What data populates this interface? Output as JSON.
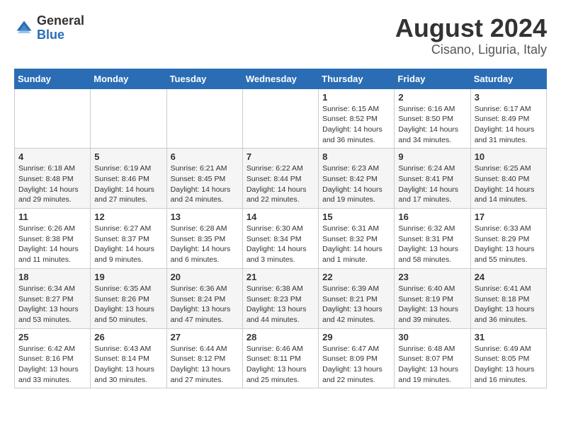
{
  "logo": {
    "general": "General",
    "blue": "Blue"
  },
  "title": "August 2024",
  "subtitle": "Cisano, Liguria, Italy",
  "days_of_week": [
    "Sunday",
    "Monday",
    "Tuesday",
    "Wednesday",
    "Thursday",
    "Friday",
    "Saturday"
  ],
  "weeks": [
    [
      {
        "day": "",
        "info": ""
      },
      {
        "day": "",
        "info": ""
      },
      {
        "day": "",
        "info": ""
      },
      {
        "day": "",
        "info": ""
      },
      {
        "day": "1",
        "info": "Sunrise: 6:15 AM\nSunset: 8:52 PM\nDaylight: 14 hours and 36 minutes."
      },
      {
        "day": "2",
        "info": "Sunrise: 6:16 AM\nSunset: 8:50 PM\nDaylight: 14 hours and 34 minutes."
      },
      {
        "day": "3",
        "info": "Sunrise: 6:17 AM\nSunset: 8:49 PM\nDaylight: 14 hours and 31 minutes."
      }
    ],
    [
      {
        "day": "4",
        "info": "Sunrise: 6:18 AM\nSunset: 8:48 PM\nDaylight: 14 hours and 29 minutes."
      },
      {
        "day": "5",
        "info": "Sunrise: 6:19 AM\nSunset: 8:46 PM\nDaylight: 14 hours and 27 minutes."
      },
      {
        "day": "6",
        "info": "Sunrise: 6:21 AM\nSunset: 8:45 PM\nDaylight: 14 hours and 24 minutes."
      },
      {
        "day": "7",
        "info": "Sunrise: 6:22 AM\nSunset: 8:44 PM\nDaylight: 14 hours and 22 minutes."
      },
      {
        "day": "8",
        "info": "Sunrise: 6:23 AM\nSunset: 8:42 PM\nDaylight: 14 hours and 19 minutes."
      },
      {
        "day": "9",
        "info": "Sunrise: 6:24 AM\nSunset: 8:41 PM\nDaylight: 14 hours and 17 minutes."
      },
      {
        "day": "10",
        "info": "Sunrise: 6:25 AM\nSunset: 8:40 PM\nDaylight: 14 hours and 14 minutes."
      }
    ],
    [
      {
        "day": "11",
        "info": "Sunrise: 6:26 AM\nSunset: 8:38 PM\nDaylight: 14 hours and 11 minutes."
      },
      {
        "day": "12",
        "info": "Sunrise: 6:27 AM\nSunset: 8:37 PM\nDaylight: 14 hours and 9 minutes."
      },
      {
        "day": "13",
        "info": "Sunrise: 6:28 AM\nSunset: 8:35 PM\nDaylight: 14 hours and 6 minutes."
      },
      {
        "day": "14",
        "info": "Sunrise: 6:30 AM\nSunset: 8:34 PM\nDaylight: 14 hours and 3 minutes."
      },
      {
        "day": "15",
        "info": "Sunrise: 6:31 AM\nSunset: 8:32 PM\nDaylight: 14 hours and 1 minute."
      },
      {
        "day": "16",
        "info": "Sunrise: 6:32 AM\nSunset: 8:31 PM\nDaylight: 13 hours and 58 minutes."
      },
      {
        "day": "17",
        "info": "Sunrise: 6:33 AM\nSunset: 8:29 PM\nDaylight: 13 hours and 55 minutes."
      }
    ],
    [
      {
        "day": "18",
        "info": "Sunrise: 6:34 AM\nSunset: 8:27 PM\nDaylight: 13 hours and 53 minutes."
      },
      {
        "day": "19",
        "info": "Sunrise: 6:35 AM\nSunset: 8:26 PM\nDaylight: 13 hours and 50 minutes."
      },
      {
        "day": "20",
        "info": "Sunrise: 6:36 AM\nSunset: 8:24 PM\nDaylight: 13 hours and 47 minutes."
      },
      {
        "day": "21",
        "info": "Sunrise: 6:38 AM\nSunset: 8:23 PM\nDaylight: 13 hours and 44 minutes."
      },
      {
        "day": "22",
        "info": "Sunrise: 6:39 AM\nSunset: 8:21 PM\nDaylight: 13 hours and 42 minutes."
      },
      {
        "day": "23",
        "info": "Sunrise: 6:40 AM\nSunset: 8:19 PM\nDaylight: 13 hours and 39 minutes."
      },
      {
        "day": "24",
        "info": "Sunrise: 6:41 AM\nSunset: 8:18 PM\nDaylight: 13 hours and 36 minutes."
      }
    ],
    [
      {
        "day": "25",
        "info": "Sunrise: 6:42 AM\nSunset: 8:16 PM\nDaylight: 13 hours and 33 minutes."
      },
      {
        "day": "26",
        "info": "Sunrise: 6:43 AM\nSunset: 8:14 PM\nDaylight: 13 hours and 30 minutes."
      },
      {
        "day": "27",
        "info": "Sunrise: 6:44 AM\nSunset: 8:12 PM\nDaylight: 13 hours and 27 minutes."
      },
      {
        "day": "28",
        "info": "Sunrise: 6:46 AM\nSunset: 8:11 PM\nDaylight: 13 hours and 25 minutes."
      },
      {
        "day": "29",
        "info": "Sunrise: 6:47 AM\nSunset: 8:09 PM\nDaylight: 13 hours and 22 minutes."
      },
      {
        "day": "30",
        "info": "Sunrise: 6:48 AM\nSunset: 8:07 PM\nDaylight: 13 hours and 19 minutes."
      },
      {
        "day": "31",
        "info": "Sunrise: 6:49 AM\nSunset: 8:05 PM\nDaylight: 13 hours and 16 minutes."
      }
    ]
  ]
}
